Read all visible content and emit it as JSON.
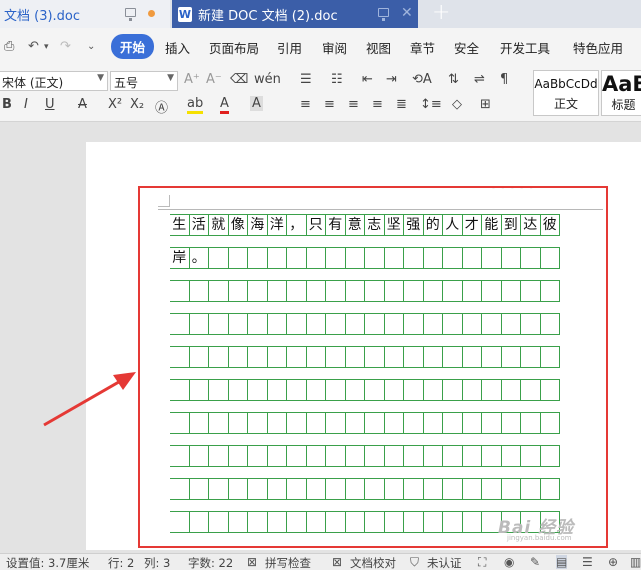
{
  "tabs": [
    {
      "label": "文档 (3).doc"
    },
    {
      "label": "新建 DOC 文档 (2).doc"
    }
  ],
  "menu": {
    "items": [
      "开始",
      "插入",
      "页面布局",
      "引用",
      "审阅",
      "视图",
      "章节",
      "安全",
      "开发工具",
      "特色应用"
    ]
  },
  "ribbon": {
    "font_name": "宋体 (正文)",
    "font_size": "五号",
    "styles": [
      {
        "sample": "AaBbCcDd",
        "name": "正文"
      },
      {
        "sample": "AaB",
        "name": "标题"
      }
    ]
  },
  "document": {
    "header_mark": "- - - - -",
    "rows": [
      [
        "生",
        "活",
        "就",
        "像",
        "海",
        "洋",
        "，",
        "只",
        "有",
        "意",
        "志",
        "坚",
        "强",
        "的",
        "人",
        "才",
        "能",
        "到",
        "达",
        "彼"
      ],
      [
        "岸",
        "。",
        "",
        "",
        "",
        "",
        "",
        "",
        "",
        "",
        "",
        "",
        "",
        "",
        "",
        "",
        "",
        "",
        "",
        ""
      ]
    ],
    "empty_rows": 9
  },
  "status": {
    "setting": "设置值: 3.7厘米",
    "row": "行: 2",
    "col": "列: 3",
    "chars": "字数: 22",
    "spell": "拼写检查",
    "proof": "文档校对",
    "cert": "未认证"
  },
  "watermark": {
    "text": "Bai 经验",
    "sub": "jingyan.baidu.com"
  },
  "colors": {
    "accent": "#3a6fd8",
    "grid": "#3aa04a",
    "highlight_frame": "#e53935"
  }
}
